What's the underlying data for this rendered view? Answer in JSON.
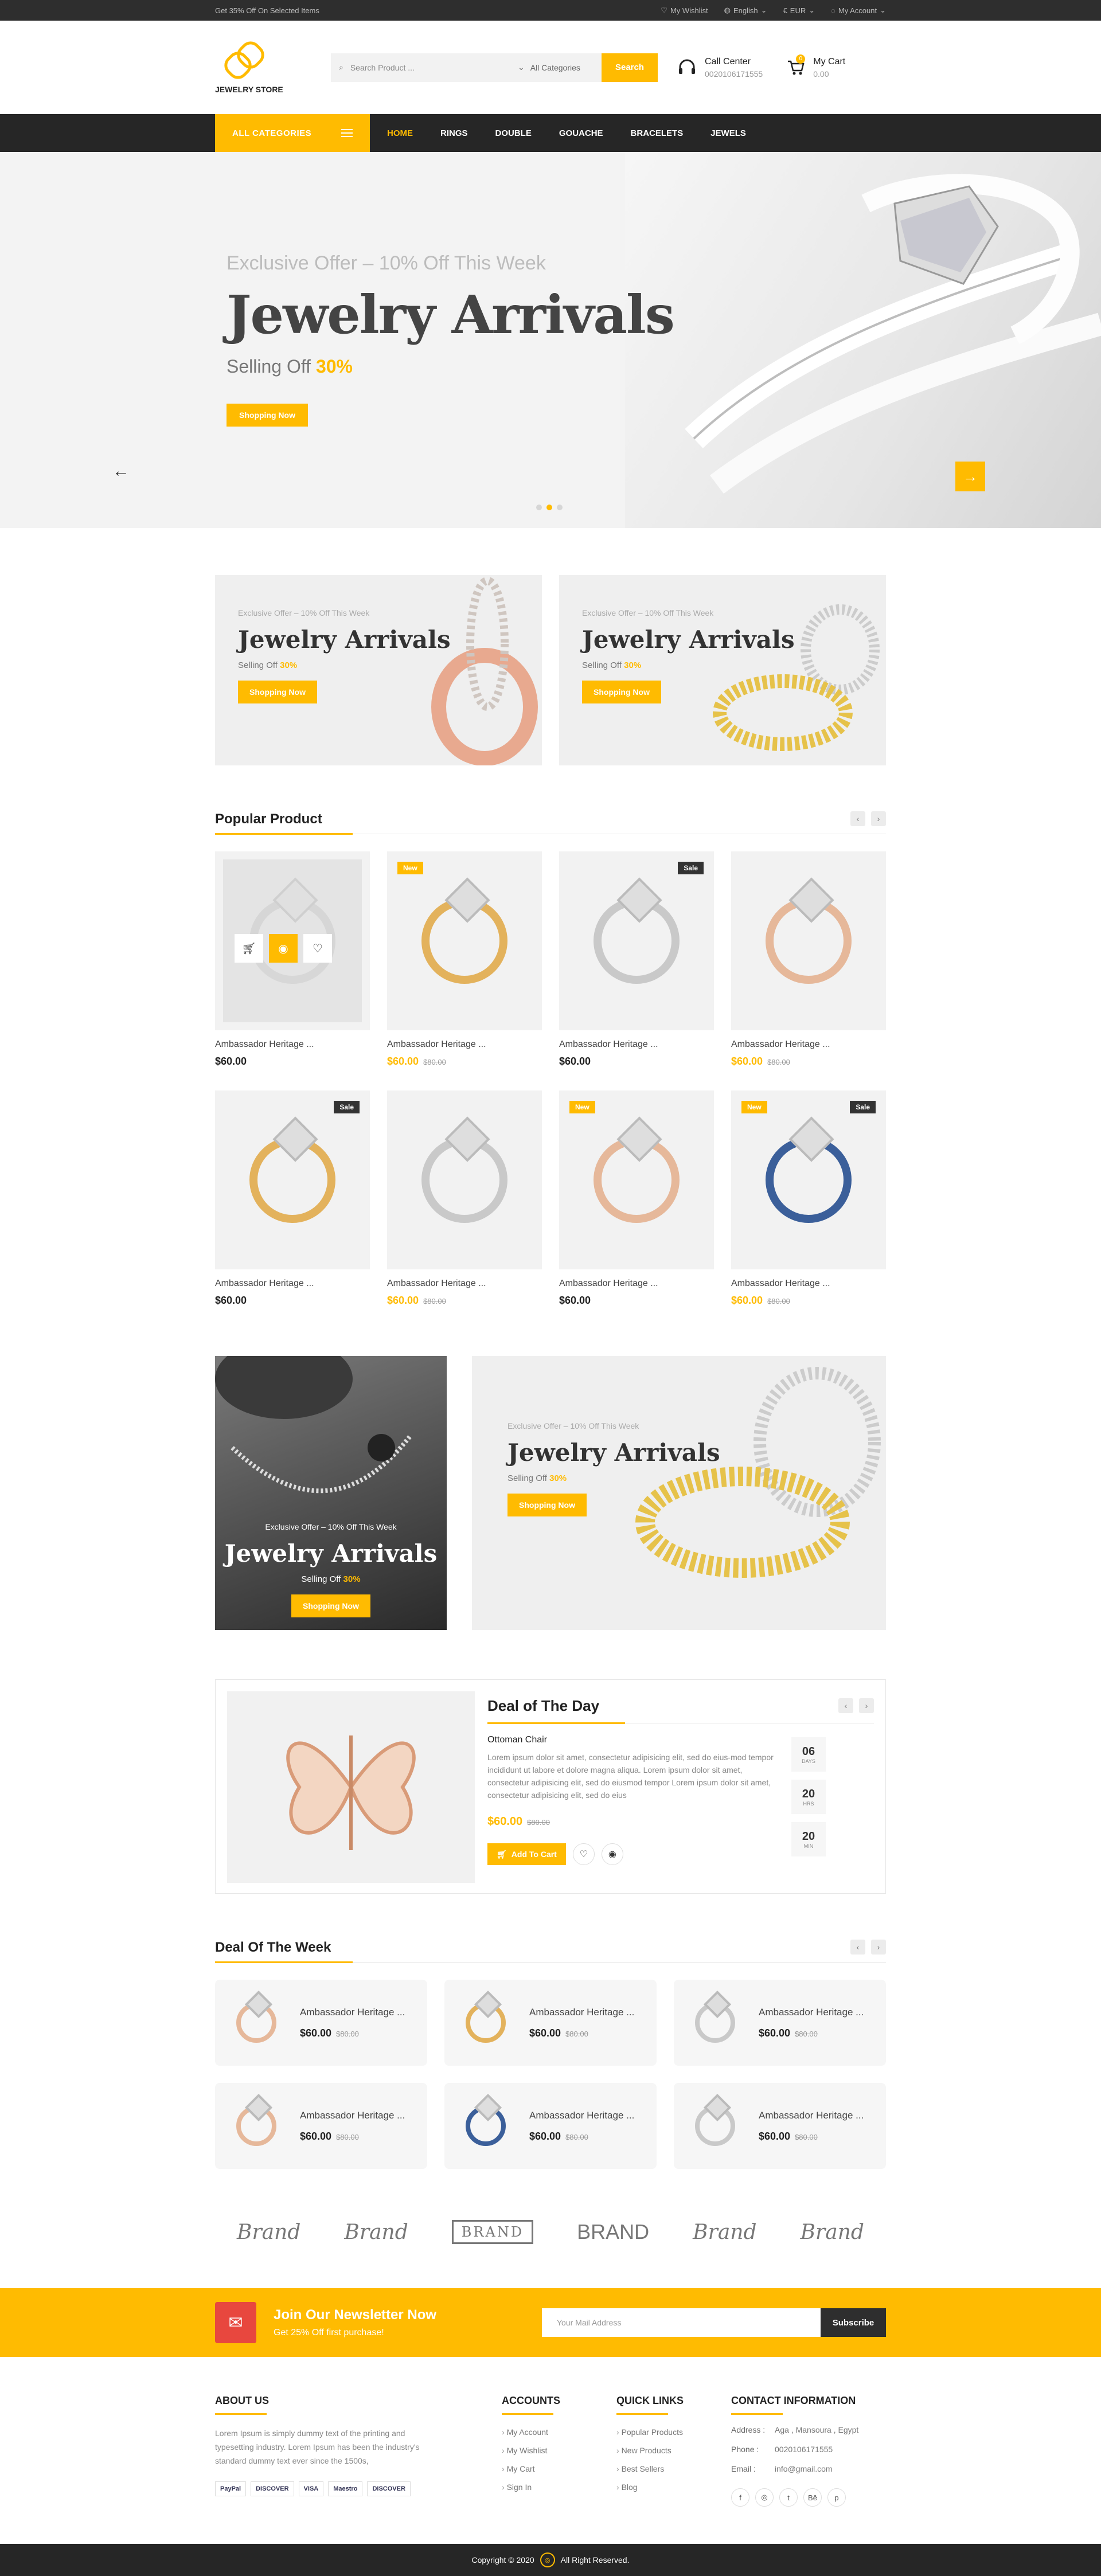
{
  "topbar": {
    "promo": "Get 35% Off On Selected Items",
    "wishlist": "My Wishlist",
    "language": "English",
    "currency": "EUR",
    "account": "My Account"
  },
  "header": {
    "logo_text": "JEWELRY STORE",
    "search_placeholder": "Search Product ...",
    "category": "All Categories",
    "search_btn": "Search",
    "call_title": "Call Center",
    "call_number": "0020106171555",
    "cart_title": "My Cart",
    "cart_total": "0.00",
    "cart_count": "0"
  },
  "nav": {
    "all_categories": "ALL  CATEGORIES",
    "items": [
      "HOME",
      "RINGS",
      "DOUBLE",
      "GOUACHE",
      "BRACELETS",
      "JEWELS"
    ]
  },
  "hero": {
    "subtitle": "Exclusive Offer – 10% Off This Week",
    "title": "Jewelry Arrivals",
    "selling": "Selling Off",
    "selling_pct": "30%",
    "button": "Shopping Now"
  },
  "banners": [
    {
      "subtitle": "Exclusive Offer – 10% Off This Week",
      "title": "Jewelry Arrivals",
      "selling": "Selling Off",
      "pct": "30%",
      "button": "Shopping Now"
    },
    {
      "subtitle": "Exclusive Offer – 10% Off This Week",
      "title": "Jewelry Arrivals",
      "selling": "Selling Off",
      "pct": "30%",
      "button": "Shopping Now"
    }
  ],
  "popular": {
    "title": "Popular Product",
    "products": [
      {
        "name": "Ambassador Heritage ...",
        "price": "$60.00",
        "old": "",
        "tag": ""
      },
      {
        "name": "Ambassador Heritage ...",
        "price": "$60.00",
        "old": "$80.00",
        "tag": "New"
      },
      {
        "name": "Ambassador Heritage ...",
        "price": "$60.00",
        "old": "",
        "tag": "Sale"
      },
      {
        "name": "Ambassador Heritage ...",
        "price": "$60.00",
        "old": "$80.00",
        "tag": ""
      },
      {
        "name": "Ambassador Heritage ...",
        "price": "$60.00",
        "old": "",
        "tag": "Sale"
      },
      {
        "name": "Ambassador Heritage ...",
        "price": "$60.00",
        "old": "$80.00",
        "tag": ""
      },
      {
        "name": "Ambassador Heritage ...",
        "price": "$60.00",
        "old": "",
        "tag": "New"
      },
      {
        "name": "Ambassador Heritage ...",
        "price": "$60.00",
        "old": "$80.00",
        "tag": "New Sale"
      }
    ]
  },
  "promo": {
    "dark": {
      "subtitle": "Exclusive Offer – 10% Off This Week",
      "title": "Jewelry Arrivals",
      "selling": "Selling Off",
      "pct": "30%",
      "button": "Shopping Now"
    },
    "light": {
      "subtitle": "Exclusive Offer – 10% Off This Week",
      "title": "Jewelry Arrivals",
      "selling": "Selling Off",
      "pct": "30%",
      "button": "Shopping Now"
    }
  },
  "deal_day": {
    "title": "Deal of The Day",
    "product": "Ottoman Chair",
    "desc": "Lorem ipsum dolor sit amet, consectetur adipisicing elit, sed do eius-mod tempor incididunt ut labore et dolore magna aliqua. Lorem ipsum dolor sit amet, consectetur adipisicing elit, sed do eiusmod tempor Lorem ipsum dolor sit amet, consectetur adipisicing elit, sed do eius",
    "price": "$60.00",
    "old": "$80.00",
    "add_cart": "Add To Cart",
    "timer": [
      {
        "v": "06",
        "l": "DAYS"
      },
      {
        "v": "20",
        "l": "HRS"
      },
      {
        "v": "20",
        "l": "MIN"
      }
    ]
  },
  "deal_week": {
    "title": "Deal Of The Week",
    "items": [
      {
        "name": "Ambassador Heritage ...",
        "price": "$60.00",
        "old": "$80.00"
      },
      {
        "name": "Ambassador Heritage ...",
        "price": "$60.00",
        "old": "$80.00"
      },
      {
        "name": "Ambassador Heritage ...",
        "price": "$60.00",
        "old": "$80.00"
      },
      {
        "name": "Ambassador Heritage ...",
        "price": "$60.00",
        "old": "$80.00"
      },
      {
        "name": "Ambassador Heritage ...",
        "price": "$60.00",
        "old": "$80.00"
      },
      {
        "name": "Ambassador Heritage ...",
        "price": "$60.00",
        "old": "$80.00"
      }
    ]
  },
  "brands": [
    "Brand",
    "Brand",
    "BRAND",
    "BRAND",
    "Brand",
    "Brand"
  ],
  "newsletter": {
    "title": "Join Our Newsletter Now",
    "sub": "Get 25% Off first purchase!",
    "placeholder": "Your Mail Address",
    "button": "Subscribe"
  },
  "footer": {
    "about_title": "ABOUT US",
    "about_text": "Lorem Ipsum is simply dummy text of the printing and typesetting industry. Lorem Ipsum has been the industry's standard dummy text ever since the 1500s,",
    "payments": [
      "PayPal",
      "DISCOVER",
      "VISA",
      "Maestro",
      "DISCOVER"
    ],
    "accounts_title": "ACCOUNTS",
    "accounts": [
      "My Account",
      "My Wishlist",
      "My Cart",
      "Sign In"
    ],
    "links_title": "QUICK LINKS",
    "links": [
      "Popular Products",
      "New Products",
      "Best Sellers",
      "Blog"
    ],
    "contact_title": "CONTACT INFORMATION",
    "contact": [
      {
        "k": "Address :",
        "v": "Aga , Mansoura , Egypt"
      },
      {
        "k": "Phone :",
        "v": "0020106171555"
      },
      {
        "k": "Email :",
        "v": "info@gmail.com"
      }
    ],
    "socials": [
      "f",
      "◎",
      "t",
      "Bē",
      "p"
    ],
    "copyright": "Copyright © 2020",
    "rights": "All Right Reserved."
  }
}
